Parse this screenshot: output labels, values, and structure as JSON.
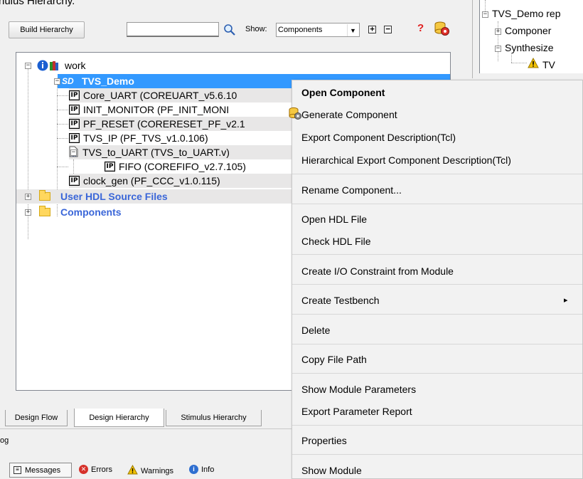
{
  "page_title_cropped": "nulus Hierarchy.",
  "toolbar": {
    "build_button": "Build Hierarchy",
    "search_value": "",
    "show_label": "Show:",
    "show_value": "Components",
    "expand_all": "+",
    "collapse_all": "−",
    "help_icon_glyph": "?"
  },
  "tree": {
    "root": "work",
    "top": "TVS_Demo",
    "children": [
      "Core_UART (COREUART_v5.6.10",
      "INIT_MONITOR (PF_INIT_MONI",
      "PF_RESET (CORERESET_PF_v2.1",
      "TVS_IP (PF_TVS_v1.0.106)",
      "TVS_to_UART (TVS_to_UART.v)",
      "FIFO (COREFIFO_v2.7.105)",
      "clock_gen (PF_CCC_v1.0.115)"
    ],
    "folders": [
      "User HDL Source Files",
      "Components"
    ]
  },
  "right_panel": {
    "items": [
      "TVS_Demo rep",
      "Componer",
      "Synthesize",
      "TV"
    ]
  },
  "tabs": [
    "Design Flow",
    "Design Hierarchy",
    "Stimulus Hierarchy"
  ],
  "log_label": "og",
  "status_bar": {
    "messages": "Messages",
    "errors": "Errors",
    "warnings": "Warnings",
    "info": "Info"
  },
  "context_menu": {
    "items": [
      "Open Component",
      "Generate Component",
      "Export Component Description(Tcl)",
      "Hierarchical Export Component Description(Tcl)",
      "Rename Component...",
      "Open HDL File",
      "Check HDL File",
      "Create I/O Constraint from Module",
      "Create Testbench",
      "Delete",
      "Copy File Path",
      "Show Module Parameters",
      "Export Parameter Report",
      "Properties",
      "Show Module"
    ],
    "submenu_arrow": "▸"
  },
  "colors": {
    "selection": "#3399ff",
    "folder_text": "#3a66d8",
    "warning": "#f2c200",
    "error": "#d6312a",
    "info": "#2f6fd0"
  }
}
